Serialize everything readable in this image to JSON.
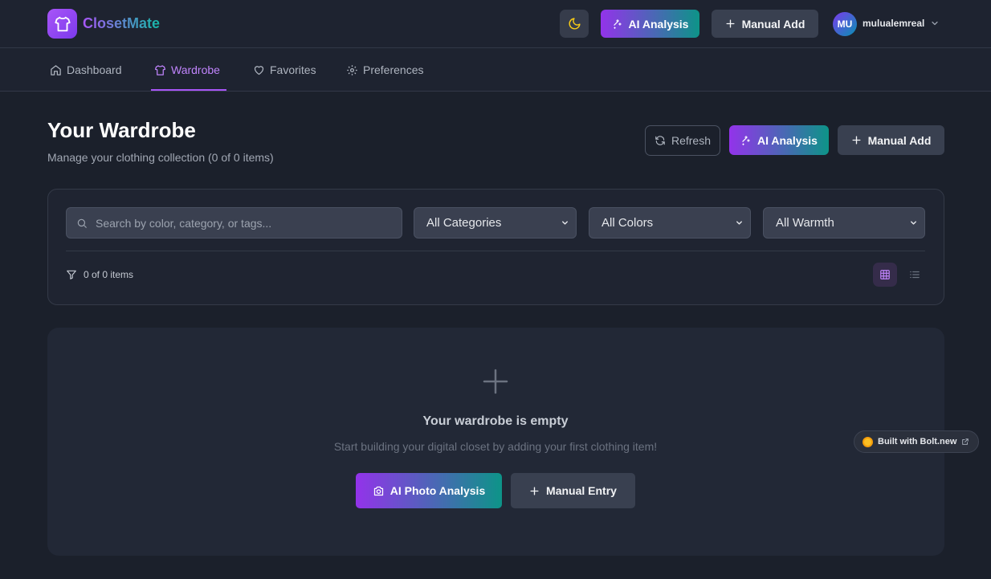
{
  "app": {
    "name": "ClosetMate"
  },
  "header": {
    "ai_analysis_label": "AI Analysis",
    "manual_add_label": "Manual Add",
    "avatar_initials": "MU",
    "username": "mulualemreal"
  },
  "nav": {
    "items": [
      {
        "label": "Dashboard",
        "icon": "home-icon"
      },
      {
        "label": "Wardrobe",
        "icon": "shirt-icon",
        "active": true
      },
      {
        "label": "Favorites",
        "icon": "heart-icon"
      },
      {
        "label": "Preferences",
        "icon": "gear-icon"
      }
    ]
  },
  "page": {
    "title": "Your Wardrobe",
    "subtitle": "Manage your clothing collection (0 of 0 items)",
    "refresh_label": "Refresh",
    "ai_analysis_label": "AI Analysis",
    "manual_add_label": "Manual Add"
  },
  "filters": {
    "search_placeholder": "Search by color, category, or tags...",
    "category_selected": "All Categories",
    "color_selected": "All Colors",
    "warmth_selected": "All Warmth",
    "count_text": "0 of 0 items",
    "view_mode": "grid"
  },
  "empty_state": {
    "title": "Your wardrobe is empty",
    "subtitle": "Start building your digital closet by adding your first clothing item!",
    "ai_button_label": "AI Photo Analysis",
    "manual_button_label": "Manual Entry"
  },
  "badge": {
    "label": "Built with Bolt.new"
  },
  "colors": {
    "accent_purple": "#a855f7",
    "accent_teal": "#0d9488",
    "background": "#1b202b"
  }
}
